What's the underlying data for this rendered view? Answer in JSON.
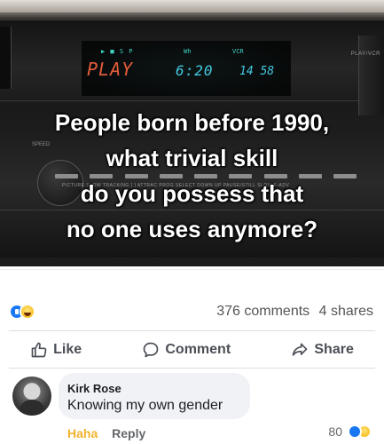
{
  "meme": {
    "display": {
      "top_left": "▶ ■ S P",
      "top_mid": "Wh",
      "top_right": "VCR",
      "mode": "PLAY",
      "time": "6:20",
      "counter": "14 58"
    },
    "vcr_labels": {
      "speed": "SPEED",
      "right_panel": "PLAY/VCR",
      "small_text": "PICTURE   SLOW    TRACKING          [  ]  ATTRAC  PROG  SELECT  DOWN     UP     PAUSE/STILL   SLOW F-ADV"
    },
    "caption_lines": [
      "People born before 1990,",
      "what trivial skill",
      "do you possess that",
      "no one uses anymore?"
    ]
  },
  "stats": {
    "reactions": [
      "like-reaction",
      "haha-reaction"
    ],
    "comments": "376 comments",
    "shares": "4 shares"
  },
  "actions": {
    "like": "Like",
    "comment": "Comment",
    "share": "Share"
  },
  "comment": {
    "author": "Kirk Rose",
    "text": "Knowing my own gender",
    "haha_label": "Haha",
    "reply_label": "Reply",
    "reaction_count": "80"
  },
  "colors": {
    "facebook_blue": "#1877f2",
    "haha_yellow": "#f5b400",
    "haha_text": "#f0b32e",
    "vcr_red": "#e25c3a",
    "vcr_cyan": "#44c9e0"
  }
}
